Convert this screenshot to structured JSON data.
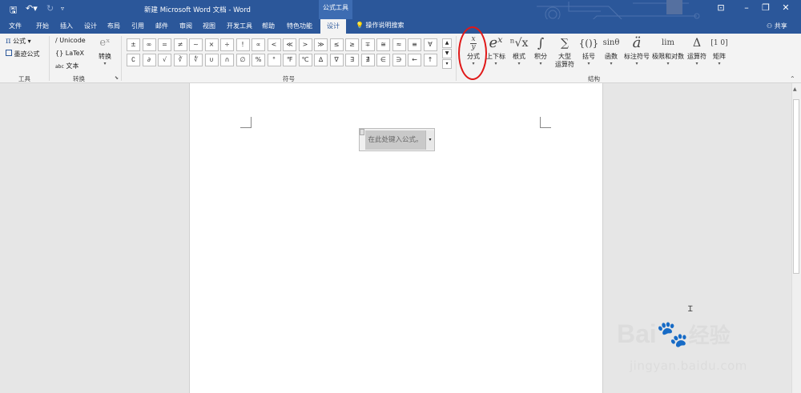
{
  "titlebar": {
    "title": "新建 Microsoft Word 文档 - Word",
    "context_label": "公式工具",
    "undo_icon": "undo-icon",
    "save_icon": "save-icon"
  },
  "tabs": [
    "文件",
    "开始",
    "插入",
    "设计",
    "布局",
    "引用",
    "邮件",
    "审阅",
    "视图",
    "开发工具",
    "帮助",
    "特色功能"
  ],
  "active_tab": "设计",
  "tell_me": "操作说明搜索",
  "share": "共享",
  "tools": {
    "equation": "公式",
    "ink_equation": "墨迹公式",
    "group": "工具"
  },
  "convert": {
    "unicode": "Unicode",
    "latex": "LaTeX",
    "text": "文本",
    "abc": "abc",
    "convert_btn": "转换",
    "group": "转换"
  },
  "symbols": {
    "group": "符号",
    "row1": [
      "±",
      "∞",
      "=",
      "≠",
      "~",
      "×",
      "÷",
      "!",
      "∝",
      "<",
      "≪",
      ">",
      "≫",
      "≤",
      "≥",
      "∓",
      "≅",
      "≈",
      "≡",
      "∀"
    ],
    "row2": [
      "∁",
      "∂",
      "√",
      "∛",
      "∜",
      "∪",
      "∩",
      "∅",
      "%",
      "°",
      "℉",
      "℃",
      "∆",
      "∇",
      "∃",
      "∄",
      "∈",
      "∋",
      "←",
      "↑"
    ]
  },
  "structures": {
    "group": "结构",
    "items": [
      {
        "label": "分式",
        "icon": "x/y",
        "name": "fraction"
      },
      {
        "label": "上下标",
        "icon": "eˣ",
        "name": "script"
      },
      {
        "label": "根式",
        "icon": "ⁿ√x",
        "name": "radical"
      },
      {
        "label": "积分",
        "icon": "∫",
        "name": "integral"
      },
      {
        "label": "大型",
        "label2": "运算符",
        "icon": "∑",
        "name": "large-operator"
      },
      {
        "label": "括号",
        "icon": "{()}",
        "name": "bracket"
      },
      {
        "label": "函数",
        "icon": "sinθ",
        "name": "function"
      },
      {
        "label": "标注符号",
        "icon": "ä",
        "name": "accent"
      },
      {
        "label": "极限和对数",
        "icon": "lim",
        "name": "limit-log"
      },
      {
        "label": "运算符",
        "icon": "Δ",
        "name": "operator"
      },
      {
        "label": "矩阵",
        "icon": "[1 0]",
        "name": "matrix"
      }
    ]
  },
  "document": {
    "equation_placeholder": "在此处键入公式。"
  },
  "watermark": {
    "brand": "Bai",
    "brand_cn": "经验",
    "url": "jingyan.baidu.com"
  },
  "accent": "#2b579a",
  "highlight": "#e01818"
}
